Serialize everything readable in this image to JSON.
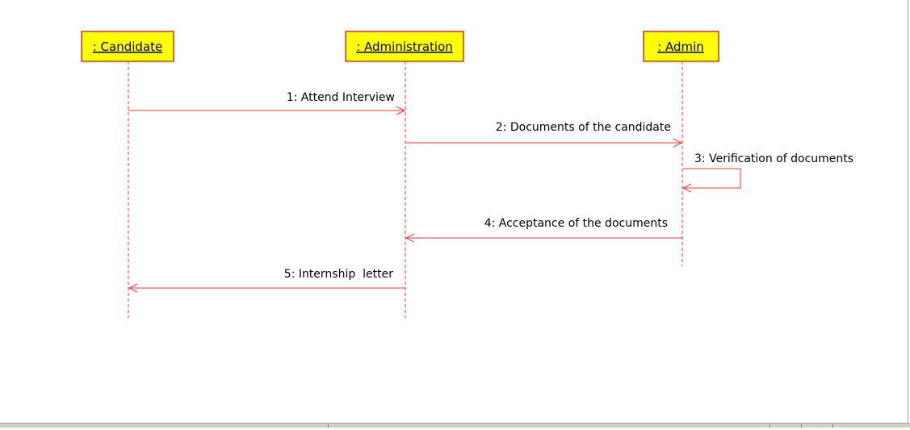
{
  "lifelines": [
    {
      "id": "candidate",
      "label": ": Candidate"
    },
    {
      "id": "administration",
      "label": ": Administration"
    },
    {
      "id": "admin",
      "label": ": Admin"
    }
  ],
  "messages": [
    {
      "label": "1: Attend Interview",
      "from": "candidate",
      "to": "administration"
    },
    {
      "label": "2: Documents of the candidate",
      "from": "administration",
      "to": "admin"
    },
    {
      "label": "3: Verification of documents",
      "from": "admin",
      "to": "admin"
    },
    {
      "label": "4: Acceptance of the documents",
      "from": "admin",
      "to": "administration"
    },
    {
      "label": "5: Internship  letter",
      "from": "administration",
      "to": "candidate"
    }
  ],
  "colors": {
    "lifeline_fill": "#ffff00",
    "lifeline_border": "#cc0000",
    "line": "#ff3333"
  }
}
